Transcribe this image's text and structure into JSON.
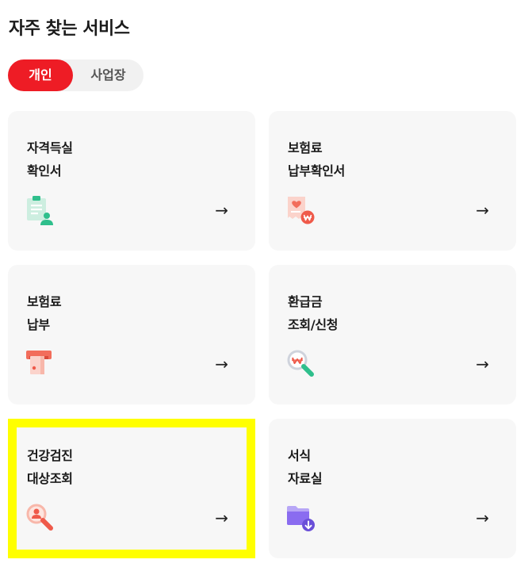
{
  "section": {
    "title": "자주 찾는 서비스"
  },
  "toggle": {
    "personal": "개인",
    "business": "사업장",
    "active": "personal"
  },
  "cards": [
    {
      "line1": "자격득실",
      "line2": "확인서",
      "icon": "document-person-icon",
      "arrow": "→"
    },
    {
      "line1": "보험료",
      "line2": "납부확인서",
      "icon": "receipt-won-icon",
      "arrow": "→"
    },
    {
      "line1": "보험료",
      "line2": "납부",
      "icon": "card-payment-icon",
      "arrow": "→"
    },
    {
      "line1": "환급금",
      "line2": "조회/신청",
      "icon": "search-won-icon",
      "arrow": "→"
    },
    {
      "line1": "건강검진",
      "line2": "대상조회",
      "icon": "search-person-icon",
      "arrow": "→"
    },
    {
      "line1": "서식",
      "line2": "자료실",
      "icon": "folder-download-icon",
      "arrow": "→"
    }
  ],
  "colors": {
    "accent": "#ee1c25",
    "highlight": "#ffff00",
    "green": "#2fbf8c",
    "coral": "#f26d5b",
    "purple": "#8a6cf0"
  }
}
